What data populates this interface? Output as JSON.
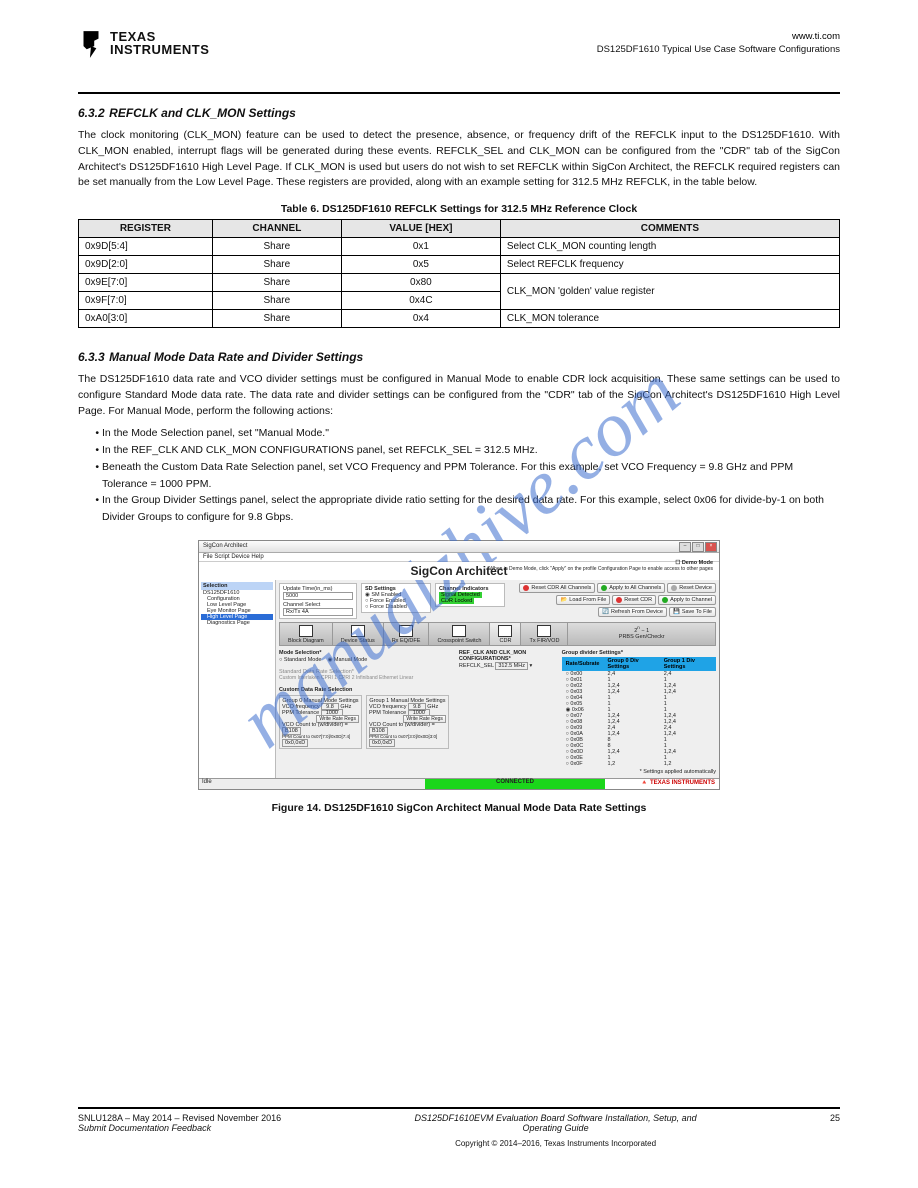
{
  "hdr": {
    "logo_top": "TEXAS",
    "logo_bot": "INSTRUMENTS",
    "right_url": "www.ti.com",
    "right_title": "DS125DF1610 Typical Use Case Software Configurations"
  },
  "sec": {
    "num": "6.3.2",
    "title": "REFCLK and CLK_MON Settings",
    "p1": "The clock monitoring (CLK_MON) feature can be used to detect the presence, absence, or frequency drift of the REFCLK input to the DS125DF1610. With CLK_MON enabled, interrupt flags will be generated during these events. REFCLK_SEL and CLK_MON can be configured from the \"CDR\" tab of the SigCon Architect's DS125DF1610 High Level Page. If CLK_MON is used but users do not wish to set REFCLK within SigCon Architect, the REFCLK required registers can be set manually from the Low Level Page. These registers are provided, along with an example setting for 312.5 MHz REFCLK, in the table below."
  },
  "table": {
    "caption": "Table 6. DS125DF1610 REFCLK Settings for 312.5 MHz Reference Clock",
    "cols": [
      "REGISTER",
      "CHANNEL",
      "VALUE [HEX]",
      "COMMENTS"
    ],
    "rows": [
      [
        "0x9D[5:4]",
        "Share",
        "0x1",
        "Select CLK_MON counting length"
      ],
      [
        "0x9D[2:0]",
        "Share",
        "0x5",
        "Select REFCLK frequency"
      ],
      [
        "0x9E[7:0]",
        "Share",
        "0x80",
        "CLK_MON 'golden' value register"
      ],
      [
        "0x9F[7:0]",
        "Share",
        "0x4C",
        "—"
      ],
      [
        "0xA0[3:0]",
        "Share",
        "0x4",
        "CLK_MON tolerance"
      ]
    ]
  },
  "sec2": {
    "num": "6.3.3",
    "title": "Manual Mode Data Rate and Divider Settings",
    "p1": "The DS125DF1610 data rate and VCO divider settings must be configured in Manual Mode to enable CDR lock acquisition. These same settings can be used to configure Standard Mode data rate. The data rate and divider settings can be configured from the \"CDR\" tab of the SigCon Architect's DS125DF1610 High Level Page. For Manual Mode, perform the following actions:",
    "li1": "In the Mode Selection panel, set \"Manual Mode.\"",
    "li2": "In the REF_CLK AND CLK_MON CONFIGURATIONS panel, set REFCLK_SEL = 312.5 MHz.",
    "li3": "Beneath the Custom Data Rate Selection panel, set VCO Frequency and PPM Tolerance. For this example, set VCO Frequency = 9.8 GHz and PPM Tolerance = 1000 PPM.",
    "li4": "In the Group Divider Settings panel, select the appropriate divide ratio setting for the desired data rate. For this example, select 0x06 for divide-by-1 on both Divider Groups to configure for 9.8 Gbps."
  },
  "figcaption": "Figure 14. DS125DF1610 SigCon Architect Manual Mode Data Rate Settings",
  "shot": {
    "title": "SigCon Architect",
    "menu": "File   Script   Device   Help",
    "appname": "SigCon Architect",
    "demo": "Demo Mode",
    "note": "*When in Demo Mode, click \"Apply\" on the profile Configuration Page to enable access to other pages",
    "nav_hd": "Selection",
    "nav": [
      "DS125DF1610",
      "Configuration",
      "Low Level Page",
      "Eye Monitor Page",
      "High Level Page",
      "Diagnostics Page"
    ],
    "upd_hd": "Update Time(in_ms)",
    "upd_val": "5000",
    "chsel": "Channel Select",
    "chval": "Rx/Tx 4A",
    "sd_hd": "SD Settings",
    "sd1": "SM Enabled",
    "sd2": "Force Enabled",
    "sd3": "Force Disabled",
    "ci_hd": "Channel Indicators",
    "ci1": "Signal Detected",
    "ci2": "CDR Locked",
    "b_resetcdrall": "Reset CDR All Channels",
    "b_applyall": "Apply to All Channels",
    "b_resetdev": "Reset Device",
    "b_loadfile": "Load From File",
    "b_resetcdr": "Reset CDR",
    "b_applych": "Apply to Channel",
    "b_refresh": "Refresh From Device",
    "b_save": "Save To File",
    "tools": [
      "Block Diagram",
      "Device Status",
      "Rx EQ/DFE",
      "Crosspoint Switch",
      "CDR",
      "Tx FIR/VOD",
      "PRBS Gen/Checkr"
    ],
    "mode_hd": "Mode Selection*",
    "mode_std": "Standard Mode",
    "mode_man": "Manual Mode",
    "ref_hd": "REF_CLK AND CLK_MON CONFIGURATIONS*",
    "ref_lbl": "REFCLK_SEL",
    "ref_val": "312.5 MHz",
    "stdrate_hd": "Standard Data Rate Selection*",
    "stdrate_opts": "Custom   Interlaken   CPRI 1   CPRI 2   Infiniband   Ethernet   Linear",
    "custom_hd": "Custom Data Rate Selection",
    "grp0_hd": "Group 0 Manual Mode Settings",
    "grp1_hd": "Group 1 Manual Mode Settings",
    "vco_lbl": "VCO frequency",
    "vco0": "9.8",
    "vco1": "9.8",
    "ghz": "GHz",
    "ppm_lbl": "PPM Tolerance",
    "ppm0": "1000",
    "ppm1": "1000",
    "writebtn": "Write Rate Regs",
    "vcocnt_lbl": "VCO Count to (w/divider)",
    "vcocnt0": "B108",
    "vcocnt1": "B108",
    "ppmcnt_lbl0": "PPM Count to 0x07[7:0]/0x0D[7:4]",
    "ppmcnt_lbl1": "PPM Count to 0x07[3:0]/0x0D[3:0]",
    "ppmcnt0": "0x0,0xD",
    "ppmcnt1": "0x0,0xD",
    "grdiv_hd": "Group divider Settings*",
    "grdiv_cols": [
      "Rate/Subrate",
      "Group 0\nDiv Settings",
      "Group 1\nDiv Settings"
    ],
    "grdiv_rows": [
      [
        "0x00",
        "2,4",
        "2,4"
      ],
      [
        "0x01",
        "1",
        "1"
      ],
      [
        "0x02",
        "1,2,4",
        "1,2,4"
      ],
      [
        "0x03",
        "1,2,4",
        "1,2,4"
      ],
      [
        "0x04",
        "1",
        "1"
      ],
      [
        "0x05",
        "1",
        "1"
      ],
      [
        "0x06",
        "1",
        "1"
      ],
      [
        "0x07",
        "1,2,4",
        "1,2,4"
      ],
      [
        "0x08",
        "1,2,4",
        "1,2,4"
      ],
      [
        "0x09",
        "2,4",
        "2,4"
      ],
      [
        "0x0A",
        "1,2,4",
        "1,2,4"
      ],
      [
        "0x0B",
        "8",
        "1"
      ],
      [
        "0x0C",
        "8",
        "1"
      ],
      [
        "0x0D",
        "1,2,4",
        "1,2,4"
      ],
      [
        "0x0E",
        "1",
        "1"
      ],
      [
        "0x0F",
        "1,2",
        "1,2"
      ]
    ],
    "autonote": "* Settings applied automatically",
    "status": "CONNECTED",
    "tilogo": "TEXAS INSTRUMENTS",
    "idle": "Idle"
  },
  "ftr": {
    "docnum": "SNLU128A – May 2014 – Revised November 2016",
    "sub": "Submit Documentation Feedback",
    "title": "DS125DF1610EVM Evaluation Board Software Installation, Setup, and\nOperating Guide",
    "page": "25",
    "cpy": "Copyright © 2014–2016, Texas Instruments Incorporated"
  }
}
